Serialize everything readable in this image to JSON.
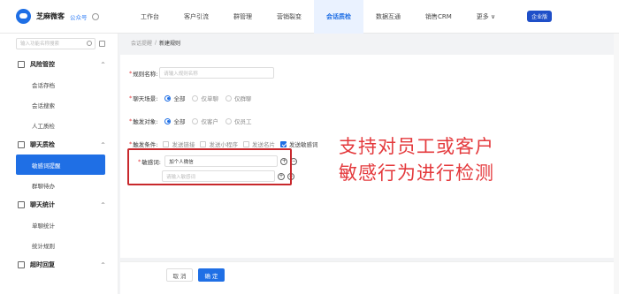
{
  "header": {
    "brand": "芝麻微客",
    "gzh": "公众号",
    "nav": [
      "工作台",
      "客户引流",
      "群管理",
      "营销裂变",
      "会话质检",
      "数据互通",
      "销售CRM",
      "更多 ∨"
    ],
    "active_nav": 4,
    "badge": "企业版",
    "accent": "#1f6fe5"
  },
  "sidebar": {
    "search_placeholder": "输入功能名称搜索",
    "groups": [
      {
        "label": "风险管控",
        "items": [
          "会话存档",
          "会话搜索",
          "人工质检"
        ]
      },
      {
        "label": "聊天质检",
        "items": [
          "敏感词提醒",
          "群聊待办"
        ]
      },
      {
        "label": "聊天统计",
        "items": [
          "单聊统计",
          "统计规则"
        ]
      },
      {
        "label": "超时回复",
        "items": []
      }
    ]
  },
  "breadcrumb": {
    "parent": "会话提醒",
    "sep": "/",
    "current": "新建规则"
  },
  "form": {
    "rule_name_label": "规则名称:",
    "rule_name_placeholder": "请输入规则名称",
    "scene_label": "聊天场景:",
    "scene_options": [
      "全部",
      "仅单聊",
      "仅群聊"
    ],
    "target_label": "触发对象:",
    "target_options": [
      "全部",
      "仅客户",
      "仅员工"
    ],
    "condition_label": "触发条件:",
    "condition_options": [
      "发送链接",
      "发送小程序",
      "发送名片",
      "发送敏感词"
    ],
    "sensitive_label": "敏感词:",
    "sensitive_value": "加个人微信",
    "sensitive_placeholder": "请输入敏感词"
  },
  "callout": {
    "line1": "支持对员工或客户",
    "line2": "敏感行为进行检测"
  },
  "footer": {
    "cancel": "取 消",
    "ok": "确 定"
  }
}
